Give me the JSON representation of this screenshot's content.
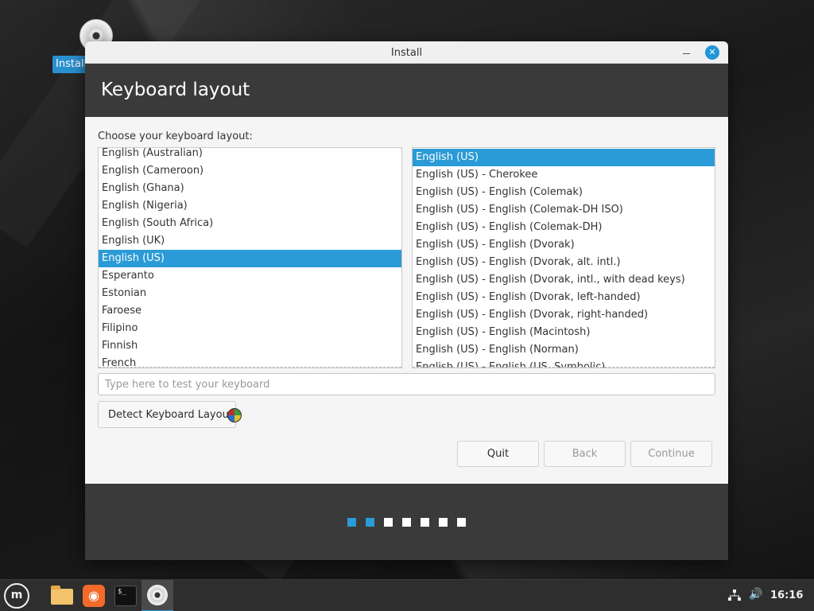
{
  "desktop": {
    "icon_label": "Install"
  },
  "window": {
    "title": "Install",
    "heading": "Keyboard layout",
    "choose_label": "Choose your keyboard layout:",
    "layouts": [
      "English (Australian)",
      "English (Cameroon)",
      "English (Ghana)",
      "English (Nigeria)",
      "English (South Africa)",
      "English (UK)",
      "English (US)",
      "Esperanto",
      "Estonian",
      "Faroese",
      "Filipino",
      "Finnish",
      "French"
    ],
    "selected_layout": "English (US)",
    "variants": [
      "English (US)",
      "English (US) - Cherokee",
      "English (US) - English (Colemak)",
      "English (US) - English (Colemak-DH ISO)",
      "English (US) - English (Colemak-DH)",
      "English (US) - English (Dvorak)",
      "English (US) - English (Dvorak, alt. intl.)",
      "English (US) - English (Dvorak, intl., with dead keys)",
      "English (US) - English (Dvorak, left-handed)",
      "English (US) - English (Dvorak, right-handed)",
      "English (US) - English (Macintosh)",
      "English (US) - English (Norman)",
      "English (US) - English (US, Symbolic)"
    ],
    "selected_variant": "English (US)",
    "test_input": {
      "placeholder": "Type here to test your keyboard",
      "value": ""
    },
    "detect_button": "Detect Keyboard Layout",
    "buttons": {
      "quit": "Quit",
      "back": "Back",
      "continue": "Continue"
    },
    "progress": {
      "total_steps": 7,
      "current_step": 2
    },
    "colors": {
      "accent": "#2a9bd6",
      "header_bg": "#3a3a3a"
    }
  },
  "taskbar": {
    "items": [
      "menu-icon",
      "files-icon",
      "firefox-icon",
      "terminal-icon",
      "install-icon"
    ],
    "terminal_prompt": "$_",
    "clock": "16:16"
  }
}
